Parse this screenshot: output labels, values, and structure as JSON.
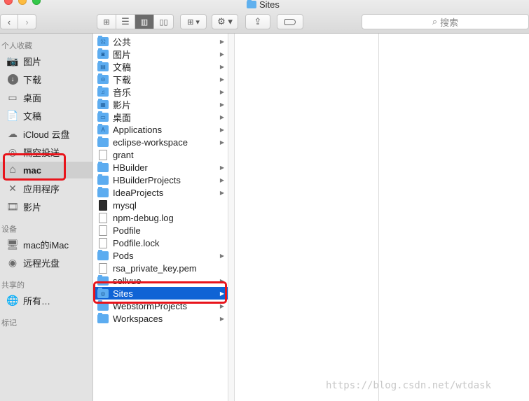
{
  "window": {
    "title": "Sites",
    "title_icon": "folder-sites-icon"
  },
  "toolbar": {
    "back_icon": "chevron-left-icon",
    "forward_icon": "chevron-right-icon",
    "view_icon": "icon-view-icon",
    "list_icon": "list-view-icon",
    "column_icon": "column-view-icon",
    "gallery_icon": "coverflow-view-icon",
    "group_icon": "group-icon",
    "action_icon": "gear-icon",
    "share_icon": "share-icon",
    "tag_icon": "tag-icon",
    "search_placeholder": "搜索"
  },
  "sidebar": {
    "sections": [
      {
        "title": "个人收藏",
        "items": [
          {
            "label": "图片",
            "icon": "camera-icon"
          },
          {
            "label": "下载",
            "icon": "download-icon"
          },
          {
            "label": "桌面",
            "icon": "desktop-icon"
          },
          {
            "label": "文稿",
            "icon": "document-icon"
          },
          {
            "label": "iCloud 云盘",
            "icon": "cloud-icon"
          },
          {
            "label": "隔空投送",
            "icon": "airdrop-icon"
          },
          {
            "label": "mac",
            "icon": "home-icon",
            "selected": true
          },
          {
            "label": "应用程序",
            "icon": "apps-icon"
          },
          {
            "label": "影片",
            "icon": "film-icon"
          }
        ]
      },
      {
        "title": "设备",
        "items": [
          {
            "label": "mac的iMac",
            "icon": "imac-icon"
          },
          {
            "label": "远程光盘",
            "icon": "disc-icon"
          }
        ]
      },
      {
        "title": "共享的",
        "items": [
          {
            "label": "所有…",
            "icon": "network-icon"
          }
        ]
      },
      {
        "title": "标记",
        "items": []
      }
    ]
  },
  "column1": [
    {
      "name": "公共",
      "type": "folder",
      "glyph": "公"
    },
    {
      "name": "图片",
      "type": "folder",
      "glyph": "◙"
    },
    {
      "name": "文稿",
      "type": "folder",
      "glyph": "▤"
    },
    {
      "name": "下载",
      "type": "folder",
      "glyph": "⊙"
    },
    {
      "name": "音乐",
      "type": "folder",
      "glyph": "♫"
    },
    {
      "name": "影片",
      "type": "folder",
      "glyph": "▦"
    },
    {
      "name": "桌面",
      "type": "folder",
      "glyph": "▭"
    },
    {
      "name": "Applications",
      "type": "folder",
      "glyph": "A"
    },
    {
      "name": "eclipse-workspace",
      "type": "folder",
      "glyph": ""
    },
    {
      "name": "grant",
      "type": "file"
    },
    {
      "name": "HBuilder",
      "type": "folder",
      "glyph": ""
    },
    {
      "name": "HBuilderProjects",
      "type": "folder",
      "glyph": ""
    },
    {
      "name": "IdeaProjects",
      "type": "folder",
      "glyph": ""
    },
    {
      "name": "mysql",
      "type": "exec"
    },
    {
      "name": "npm-debug.log",
      "type": "file"
    },
    {
      "name": "Podfile",
      "type": "file"
    },
    {
      "name": "Podfile.lock",
      "type": "file"
    },
    {
      "name": "Pods",
      "type": "folder",
      "glyph": ""
    },
    {
      "name": "rsa_private_key.pem",
      "type": "file"
    },
    {
      "name": "sellvue",
      "type": "folder",
      "glyph": ""
    },
    {
      "name": "Sites",
      "type": "folder",
      "glyph": "◎",
      "selected": true
    },
    {
      "name": "WebstormProjects",
      "type": "folder",
      "glyph": ""
    },
    {
      "name": "Workspaces",
      "type": "folder",
      "glyph": ""
    }
  ],
  "watermark": "https://blog.csdn.net/wtdask",
  "colors": {
    "selection": "#0f63d5",
    "highlight_box": "#e8141b",
    "folder": "#5cacf0"
  }
}
